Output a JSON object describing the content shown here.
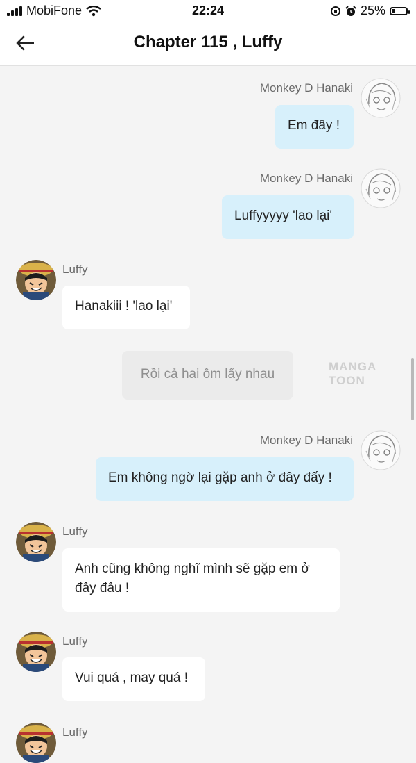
{
  "status_bar": {
    "carrier": "MobiFone",
    "time": "22:24",
    "battery": "25%",
    "battery_level": 0.25
  },
  "header": {
    "title": "Chapter 115 , Luffy"
  },
  "messages": [
    {
      "speaker": "Monkey D Hanaki",
      "text": "Em đây !"
    },
    {
      "speaker": "Monkey D Hanaki",
      "text": "Luffyyyyy 'lao lại'"
    },
    {
      "speaker": "Luffy",
      "text": "Hanakiii ! 'lao lại'"
    },
    {
      "text": "Rồi cả hai ôm lấy nhau"
    },
    {
      "speaker": "Monkey D Hanaki",
      "text": "Em không ngờ lại gặp anh ở đây đấy !"
    },
    {
      "speaker": "Luffy",
      "text": "Anh cũng không nghĩ mình sẽ gặp em ở đây đâu !"
    },
    {
      "speaker": "Luffy",
      "text": "Vui quá , may quá !"
    },
    {
      "speaker": "Luffy"
    }
  ],
  "watermark": "MANGA TOON",
  "colors": {
    "my_bubble": "#d7f0fb",
    "other_bubble": "#ffffff",
    "narration_bubble": "#ebebeb",
    "background": "#f4f4f4"
  }
}
